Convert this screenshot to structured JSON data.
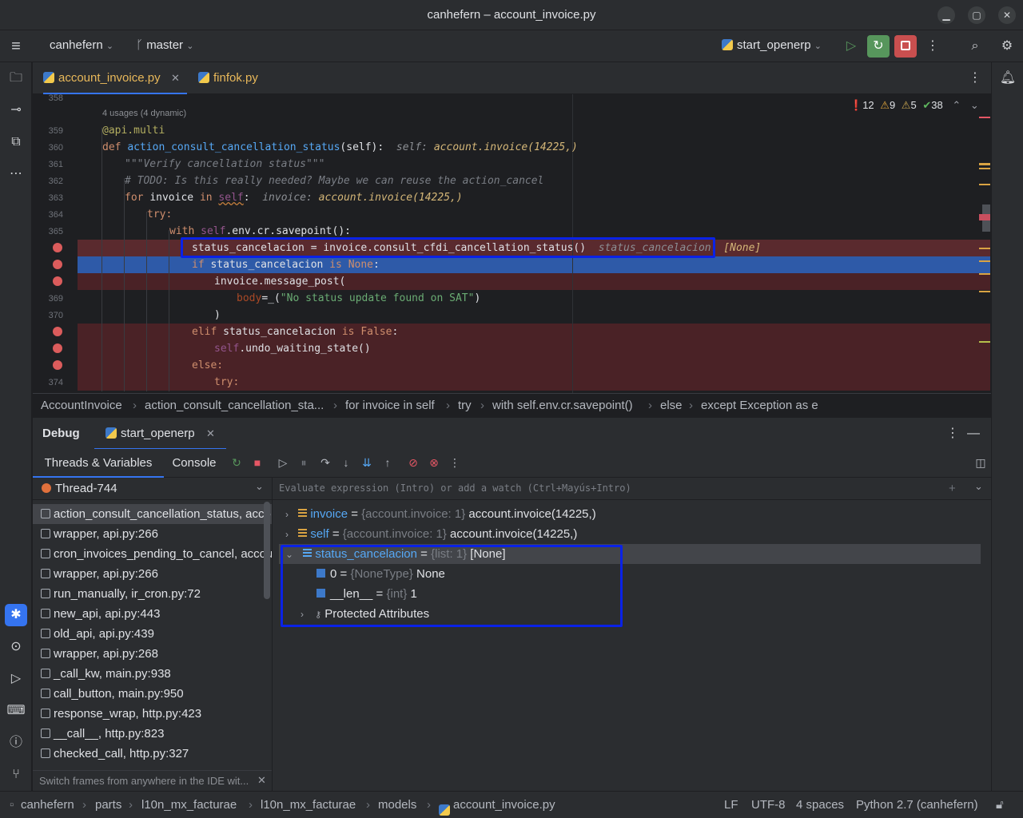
{
  "window": {
    "title": "canhefern – account_invoice.py",
    "minimize": "▁",
    "maximize": "▢",
    "close": "✕"
  },
  "toolbar": {
    "project": "canhefern",
    "branch": "master",
    "run_config": "start_openerp"
  },
  "tabs": [
    {
      "label": "account_invoice.py",
      "active": true
    },
    {
      "label": "finfok.py",
      "active": false
    }
  ],
  "editor": {
    "inspections": {
      "errors": "12",
      "warnings": "9",
      "weak_warnings": "5",
      "ok": "38"
    },
    "usages_hint": "4 usages (4 dynamic)",
    "line_numbers": [
      "358",
      "359",
      "360",
      "361",
      "362",
      "363",
      "364",
      "365",
      "369",
      "370",
      "374"
    ],
    "lines": {
      "l359": "@api.multi",
      "l360_def": "def ",
      "l360_fn": "action_consult_cancellation_status",
      "l360_rest": "(self):",
      "l360_hint_key": "self: ",
      "l360_hint_val": "account.invoice(14225,)",
      "l361": "\"\"\"Verify cancellation status\"\"\"",
      "l362": "# TODO: Is this really needed? Maybe we can reuse the action_cancel",
      "l363_for": "for ",
      "l363_mid": "invoice ",
      "l363_in": "in ",
      "l363_self": "self",
      "l363_colon": ":",
      "l363_hint_key": "invoice: ",
      "l363_hint_val": "account.invoice(14225,)",
      "l364": "try:",
      "l365_with": "with ",
      "l365_self": "self",
      "l365_rest": ".env.cr.savepoint():",
      "l366": "status_cancelacion = invoice.consult_cfdi_cancellation_status()",
      "l366_hint_key": "status_cancelacion: ",
      "l366_hint_val": "[None]",
      "l367_if": "if ",
      "l367_mid": "status_cancelacion ",
      "l367_is": "is ",
      "l367_none": "None",
      "l367_colon": ":",
      "l368": "invoice.message_post(",
      "l369_param": "body",
      "l369_eq": "=_(",
      "l369_str": "\"No status update found on SAT\"",
      "l369_close": ")",
      "l370": ")",
      "l371_elif": "elif ",
      "l371_mid": "status_cancelacion ",
      "l371_is": "is ",
      "l371_false": "False",
      "l371_colon": ":",
      "l372_self": "self",
      "l372_rest": ".undo_waiting_state()",
      "l373": "else:",
      "l374": "try:"
    }
  },
  "breadcrumb": [
    "AccountInvoice",
    "action_consult_cancellation_sta...",
    "for invoice in self",
    "try",
    "with self.env.cr.savepoint()",
    "else",
    "except Exception as e"
  ],
  "debug": {
    "title": "Debug",
    "session_tab": "start_openerp",
    "subtabs": [
      "Threads & Variables",
      "Console"
    ],
    "thread": "Thread-744",
    "eval_placeholder": "Evaluate expression (Intro) or add a watch (Ctrl+Mayús+Intro)",
    "frames": [
      "action_consult_cancellation_status, acco",
      "wrapper, api.py:266",
      "cron_invoices_pending_to_cancel, accou",
      "wrapper, api.py:266",
      "run_manually, ir_cron.py:72",
      "new_api, api.py:443",
      "old_api, api.py:439",
      "wrapper, api.py:268",
      "_call_kw, main.py:938",
      "call_button, main.py:950",
      "response_wrap, http.py:423",
      "__call__, http.py:823",
      "checked_call, http.py:327"
    ],
    "frames_tip": "Switch frames from anywhere in the IDE wit...",
    "variables": [
      {
        "name": "invoice",
        "eq": " = ",
        "type": "{account.invoice: 1}",
        "value": " account.invoice(14225,)"
      },
      {
        "name": "self",
        "eq": " = ",
        "type": "{account.invoice: 1}",
        "value": " account.invoice(14225,)"
      },
      {
        "name": "status_cancelacion",
        "eq": " = ",
        "type": "{list: 1}",
        "value": " [None]"
      }
    ],
    "children": [
      {
        "name": "0",
        "eq": " = ",
        "type": "{NoneType}",
        "value": " None"
      },
      {
        "name": "__len__",
        "eq": " = ",
        "type": "{int}",
        "value": " 1"
      },
      {
        "name": "Protected Attributes",
        "eq": "",
        "type": "",
        "value": ""
      }
    ]
  },
  "statusbar": {
    "path": [
      "canhefern",
      "parts",
      "l10n_mx_facturae",
      "l10n_mx_facturae",
      "models",
      "account_invoice.py"
    ],
    "line_sep": "LF",
    "encoding": "UTF-8",
    "indent": "4 spaces",
    "interpreter": "Python 2.7 (canhefern)"
  }
}
